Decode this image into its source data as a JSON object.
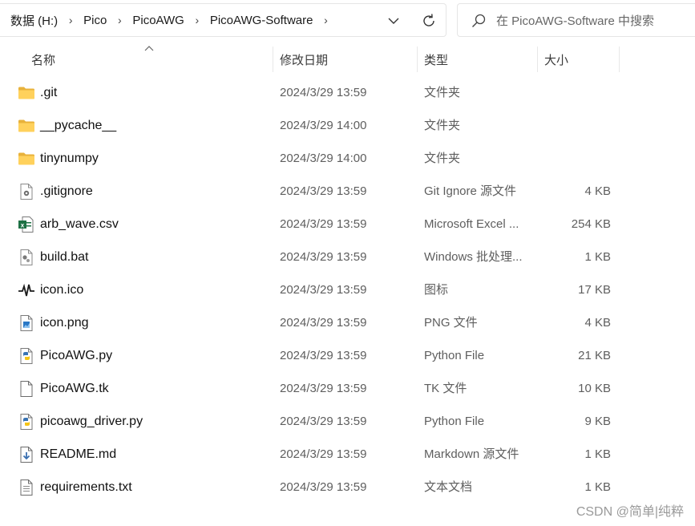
{
  "address_bar": {
    "breadcrumb": [
      "数据 (H:)",
      "Pico",
      "PicoAWG",
      "PicoAWG-Software"
    ],
    "separator": "›"
  },
  "search": {
    "placeholder": "在 PicoAWG-Software 中搜索"
  },
  "columns": {
    "name": "名称",
    "date": "修改日期",
    "type": "类型",
    "size": "大小"
  },
  "files": [
    {
      "name": ".git",
      "date": "2024/3/29 13:59",
      "type": "文件夹",
      "size": "",
      "icon": "folder-icon"
    },
    {
      "name": "__pycache__",
      "date": "2024/3/29 14:00",
      "type": "文件夹",
      "size": "",
      "icon": "folder-icon"
    },
    {
      "name": "tinynumpy",
      "date": "2024/3/29 14:00",
      "type": "文件夹",
      "size": "",
      "icon": "folder-icon"
    },
    {
      "name": ".gitignore",
      "date": "2024/3/29 13:59",
      "type": "Git Ignore 源文件",
      "size": "4 KB",
      "icon": "config-file-icon"
    },
    {
      "name": "arb_wave.csv",
      "date": "2024/3/29 13:59",
      "type": "Microsoft Excel ...",
      "size": "254 KB",
      "icon": "excel-csv-icon"
    },
    {
      "name": "build.bat",
      "date": "2024/3/29 13:59",
      "type": "Windows 批处理...",
      "size": "1 KB",
      "icon": "batch-file-icon"
    },
    {
      "name": "icon.ico",
      "date": "2024/3/29 13:59",
      "type": "图标",
      "size": "17 KB",
      "icon": "waveform-icon"
    },
    {
      "name": "icon.png",
      "date": "2024/3/29 13:59",
      "type": "PNG 文件",
      "size": "4 KB",
      "icon": "image-file-icon"
    },
    {
      "name": "PicoAWG.py",
      "date": "2024/3/29 13:59",
      "type": "Python File",
      "size": "21 KB",
      "icon": "python-file-icon"
    },
    {
      "name": "PicoAWG.tk",
      "date": "2024/3/29 13:59",
      "type": "TK 文件",
      "size": "10 KB",
      "icon": "blank-file-icon"
    },
    {
      "name": "picoawg_driver.py",
      "date": "2024/3/29 13:59",
      "type": "Python File",
      "size": "9 KB",
      "icon": "python-file-icon"
    },
    {
      "name": "README.md",
      "date": "2024/3/29 13:59",
      "type": "Markdown 源文件",
      "size": "1 KB",
      "icon": "markdown-file-icon"
    },
    {
      "name": "requirements.txt",
      "date": "2024/3/29 13:59",
      "type": "文本文档",
      "size": "1 KB",
      "icon": "text-file-icon"
    }
  ],
  "watermark": "CSDN @简单|纯粹"
}
